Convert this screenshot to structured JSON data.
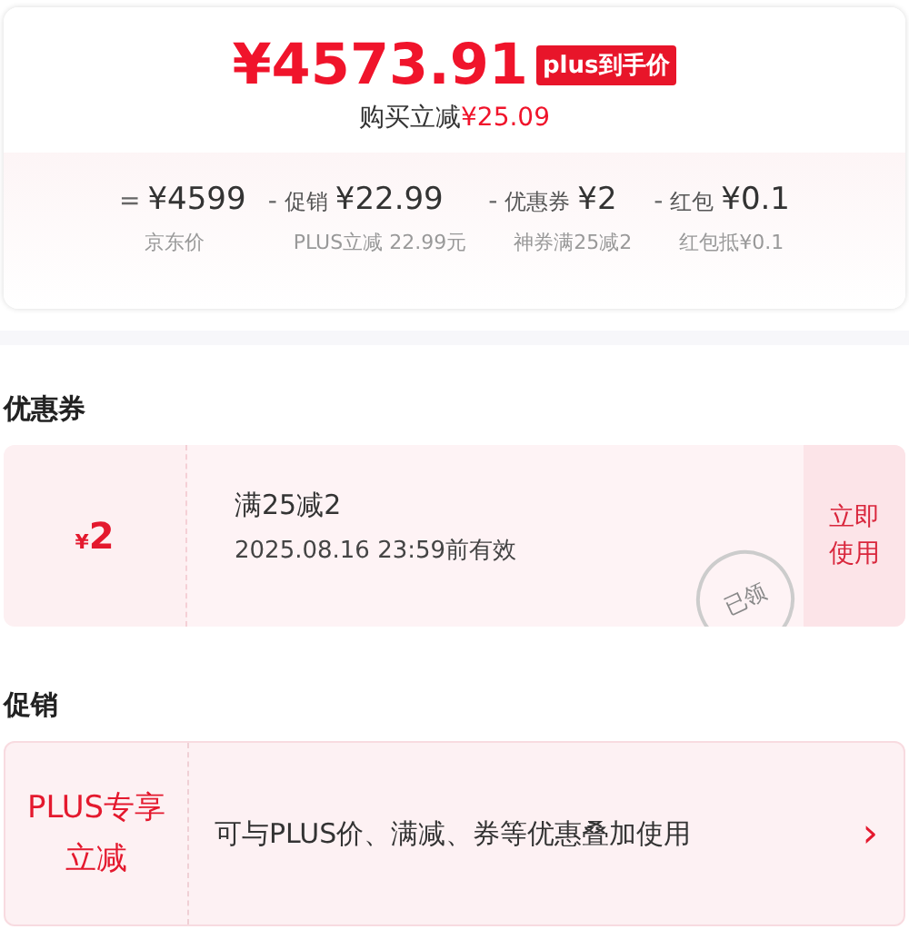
{
  "price": {
    "amount": "¥4573.91",
    "badge": "plus到手价",
    "saving_label": "购买立减",
    "saving_amount": "¥25.09"
  },
  "breakdown": [
    {
      "operator": "=",
      "amount": "¥4599",
      "note": "京东价"
    },
    {
      "operator": "-",
      "label": "促销",
      "amount": "¥22.99",
      "note": "PLUS立减 22.99元"
    },
    {
      "operator": "-",
      "label": "优惠券",
      "amount": "¥2",
      "note": "神券满25减2"
    },
    {
      "operator": "-",
      "label": "红包",
      "amount": "¥0.1",
      "note": "红包抵¥0.1"
    }
  ],
  "coupon_section": {
    "heading": "优惠券",
    "coupons": [
      {
        "currency": "¥",
        "value": "2",
        "condition": "满25减2",
        "validity": "2025.08.16 23:59前有效",
        "stamp": "已领",
        "action": "立即使用"
      }
    ]
  },
  "promo_section": {
    "heading": "促销",
    "promos": [
      {
        "tag": "PLUS专享立减",
        "description": "可与PLUS价、满减、券等优惠叠加使用",
        "chevron": "›"
      }
    ]
  }
}
